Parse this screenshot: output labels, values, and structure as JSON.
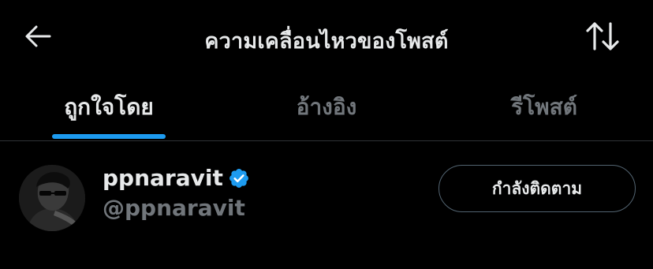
{
  "header": {
    "title": "ความเคลื่อนไหวของโพสต์",
    "back_icon": "arrow-left-icon",
    "sort_icon": "sort-arrows-icon"
  },
  "tabs": [
    {
      "label": "ถูกใจโดย",
      "active": true
    },
    {
      "label": "อ้างอิง",
      "active": false
    },
    {
      "label": "รีโพสต์",
      "active": false
    }
  ],
  "users": [
    {
      "display_name": "ppnaravit",
      "handle": "@ppnaravit",
      "verified": true,
      "follow_label": "กำลังติดตาม"
    }
  ],
  "colors": {
    "background": "#000000",
    "text_primary": "#e7e9ea",
    "text_secondary": "#71767b",
    "accent": "#1d9bf0",
    "divider": "#2f3336"
  }
}
